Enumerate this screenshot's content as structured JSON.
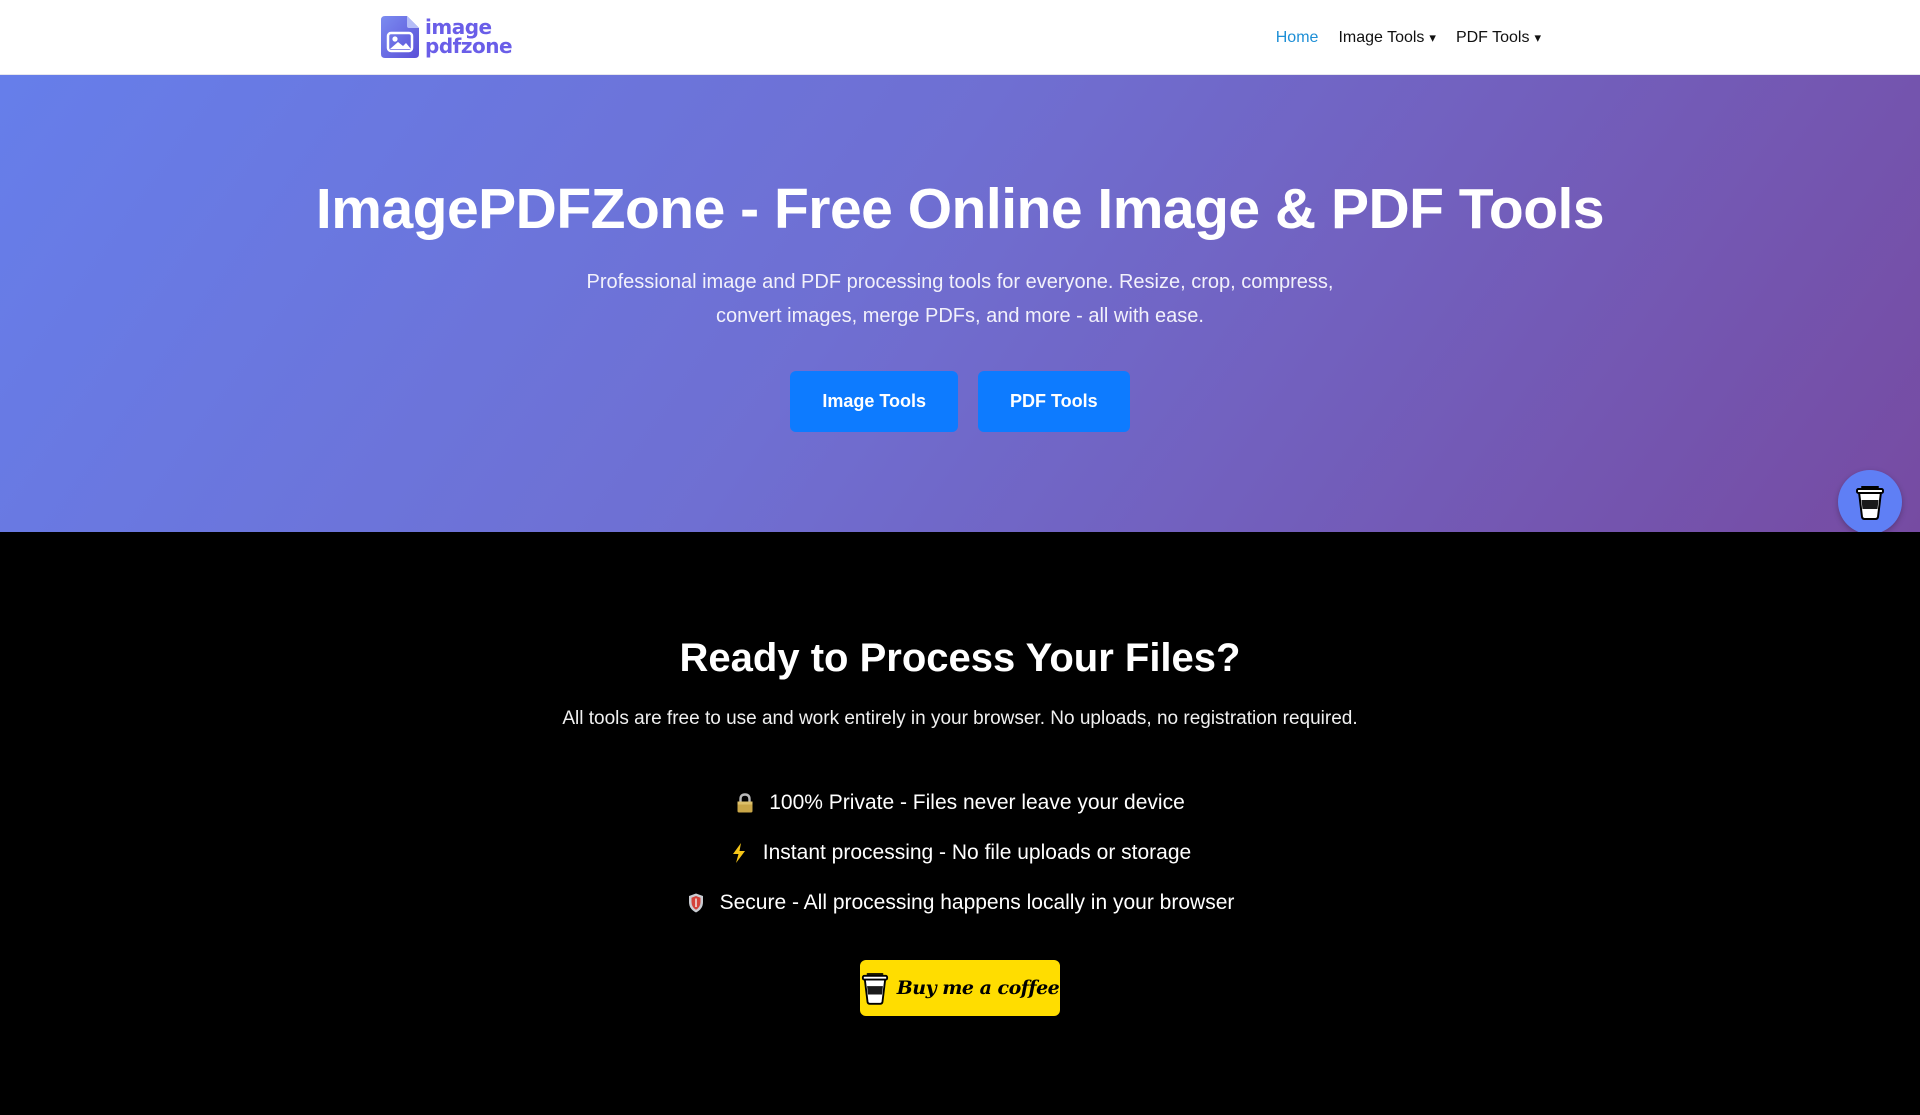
{
  "header": {
    "logo": {
      "line1": "image",
      "line2": "pdfzone",
      "icon": "image-file-icon"
    },
    "nav": [
      {
        "label": "Home",
        "active": true
      },
      {
        "label": "Image Tools",
        "caret": "▾"
      },
      {
        "label": "PDF Tools",
        "caret": "▾"
      }
    ]
  },
  "hero": {
    "title": "ImagePDFZone - Free Online Image & PDF Tools",
    "subtitle": "Professional image and PDF processing tools for everyone. Resize, crop, compress, convert images, merge PDFs, and more - all with ease.",
    "buttons": [
      "Image Tools",
      "PDF Tools"
    ]
  },
  "cta": {
    "title": "Ready to Process Your Files?",
    "description": "All tools are free to use and work entirely in your browser. No uploads, no registration required.",
    "features": [
      {
        "icon": "lock-icon",
        "text": "100% Private - Files never leave your device"
      },
      {
        "icon": "lightning-icon",
        "text": "Instant processing - No file uploads or storage"
      },
      {
        "icon": "shield-icon",
        "text": "Secure - All processing happens locally in your browser"
      }
    ],
    "coffee_button": "Buy me a coffee"
  },
  "colors": {
    "accent": "#0d7bff",
    "hero_gradient_start": "#667eea",
    "hero_gradient_end": "#764ba2",
    "coffee_yellow": "#ffdd00",
    "nav_active": "#1e8fd6",
    "logo_purple": "#6a5ee8"
  }
}
